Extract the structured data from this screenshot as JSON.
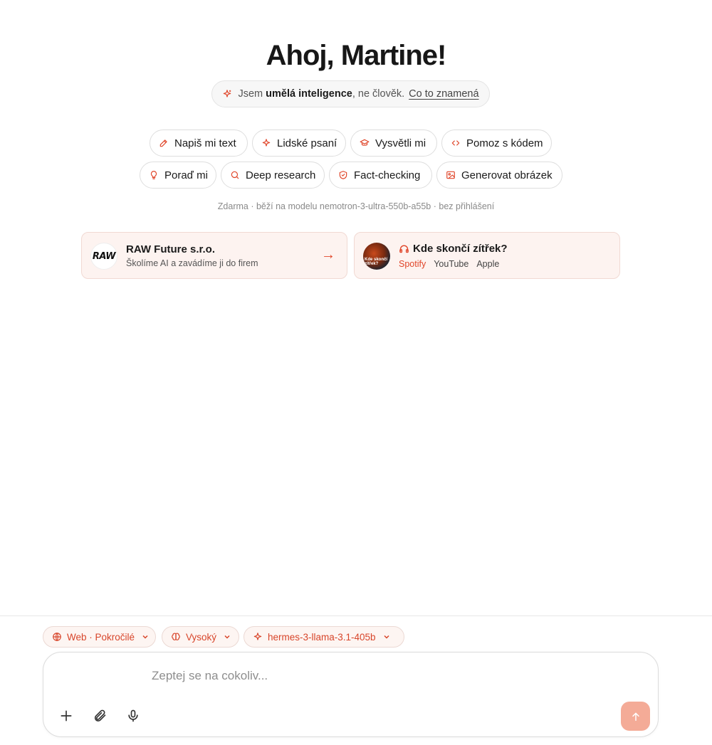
{
  "greeting": "Ahoj, Martine!",
  "ai_notice": {
    "prefix": "Jsem",
    "highlight": "umělá inteligence",
    "suffix": ", ne člověk.",
    "link": "Co to znamená"
  },
  "quick_actions": [
    {
      "label": "Napiš mi text",
      "icon": "pencil-icon"
    },
    {
      "label": "Lidské psaní",
      "icon": "sparkle-icon"
    },
    {
      "label": "Vysvětli mi",
      "icon": "graduation-cap-icon"
    },
    {
      "label": "Pomoz s kódem",
      "icon": "code-icon"
    },
    {
      "label": "Poraď mi",
      "icon": "lightbulb-icon"
    },
    {
      "label": "Deep research",
      "icon": "search-icon"
    },
    {
      "label": "Fact-checking",
      "icon": "shield-check-icon"
    },
    {
      "label": "Generovat obrázek",
      "icon": "image-icon"
    }
  ],
  "subnote": "Zdarma · běží na modelu nemotron-3-ultra-550b-a55b · bez přihlášení",
  "promo_card": {
    "logo": "RAW",
    "title": "RAW Future s.r.o.",
    "subtitle": "Školíme AI a zavádíme ji do firem",
    "arrow": "→"
  },
  "podcast_card": {
    "logo_text": "Kde skončí zítřek?",
    "title": "Kde skončí zítřek?",
    "links": [
      "Spotify",
      "YouTube",
      "Apple"
    ]
  },
  "options": {
    "web": "Web · Pokročilé",
    "level": "Vysoký",
    "model": "hermes-3-llama-3.1-405b"
  },
  "composer": {
    "placeholder": "Zeptej se na cokoliv..."
  },
  "colors": {
    "accent": "#e0462a",
    "card_bg": "#fdf3f0",
    "send_bg": "#f4ab97"
  }
}
